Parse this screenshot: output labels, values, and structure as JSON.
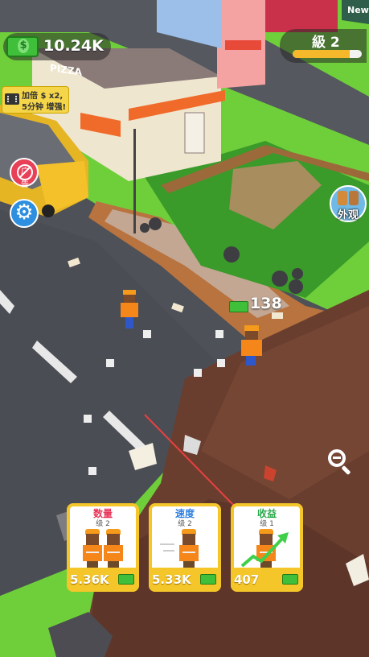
{
  "hud": {
    "money": "10.24K",
    "money_icon": "cash-icon",
    "level_label": "級 2",
    "level_progress": 0.82,
    "ad_boost_line1": "加倍 $ x2,",
    "ad_boost_line2": "5分钟 增强!",
    "no_ads_icon": "no-ads-icon",
    "no_ads_glyph": "广告",
    "settings_icon": "gear-icon",
    "build_label": "外观",
    "zoom_icon": "zoom-out-icon"
  },
  "world": {
    "floating_reward": "138",
    "shop_sign": "PIZZA",
    "corner_sign": "New"
  },
  "upgrades": [
    {
      "title": "数量",
      "level": "级 2",
      "cost": "5.36K",
      "title_color": "#e8365a"
    },
    {
      "title": "速度",
      "level": "级 2",
      "cost": "5.33K",
      "title_color": "#2e7fe0"
    },
    {
      "title": "收益",
      "level": "级 1",
      "cost": "407",
      "title_color": "#2aa84a"
    }
  ],
  "colors": {
    "accent": "#f5c62a",
    "money_green": "#3fbf3a"
  }
}
